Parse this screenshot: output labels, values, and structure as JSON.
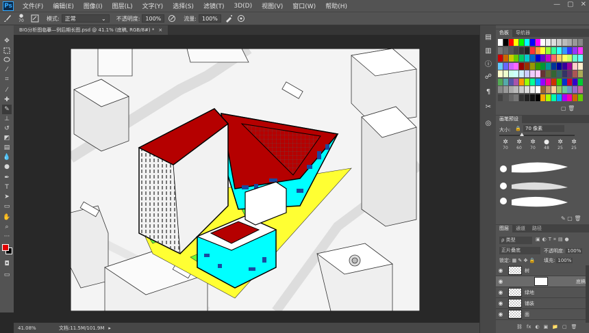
{
  "app": {
    "logo": "Ps"
  },
  "menu": [
    "文件(F)",
    "编辑(E)",
    "图像(I)",
    "图层(L)",
    "文字(Y)",
    "选择(S)",
    "滤镜(T)",
    "3D(D)",
    "视图(V)",
    "窗口(W)",
    "帮助(H)"
  ],
  "window_buttons": [
    "—",
    "▢",
    "✕"
  ],
  "options": {
    "brush_size": "70",
    "mode_label": "模式:",
    "mode_value": "正常",
    "opacity_label": "不透明度:",
    "opacity_value": "100%",
    "flow_label": "流量:",
    "flow_value": "100%"
  },
  "document_tab": {
    "title": "BIG分析图临摹—例后期长图.psd @ 41.1% (底稿, RGB/8#) *",
    "close": "×"
  },
  "status": {
    "zoom": "41.08%",
    "doc": "文档:11.5M/101.9M"
  },
  "panels": {
    "swatches_tabs": [
      "色板",
      "导航器"
    ],
    "brush_presets_tab": "画笔预设",
    "size_label": "大小:",
    "size_value": "70 像素",
    "brush_sizes": [
      "70",
      "60",
      "70",
      "48",
      "25",
      "25"
    ],
    "layers_tabs": [
      "图层",
      "通道",
      "路径"
    ],
    "kind_value": "ρ 类型",
    "blend_value": "正片叠底",
    "opacity_label": "不透明度:",
    "opacity_value": "100%",
    "lock_label": "锁定:",
    "fill_label": "填充:",
    "fill_value": "100%",
    "layers": [
      {
        "name": "树",
        "selected": false
      },
      {
        "name": "底稿",
        "selected": true
      },
      {
        "name": "绿地",
        "selected": false
      },
      {
        "name": "铺装",
        "selected": false
      },
      {
        "name": "面",
        "selected": false
      }
    ],
    "bottom_icons": [
      "⛓",
      "fx",
      "◐",
      "▣",
      "📁",
      "▢",
      "🗑"
    ]
  },
  "colors": {
    "foreground": "#e00000",
    "background": "#000000",
    "roof": "#b50000",
    "facade": "#00ffff",
    "pavement": "#ffff33",
    "green": "#66ff33"
  }
}
